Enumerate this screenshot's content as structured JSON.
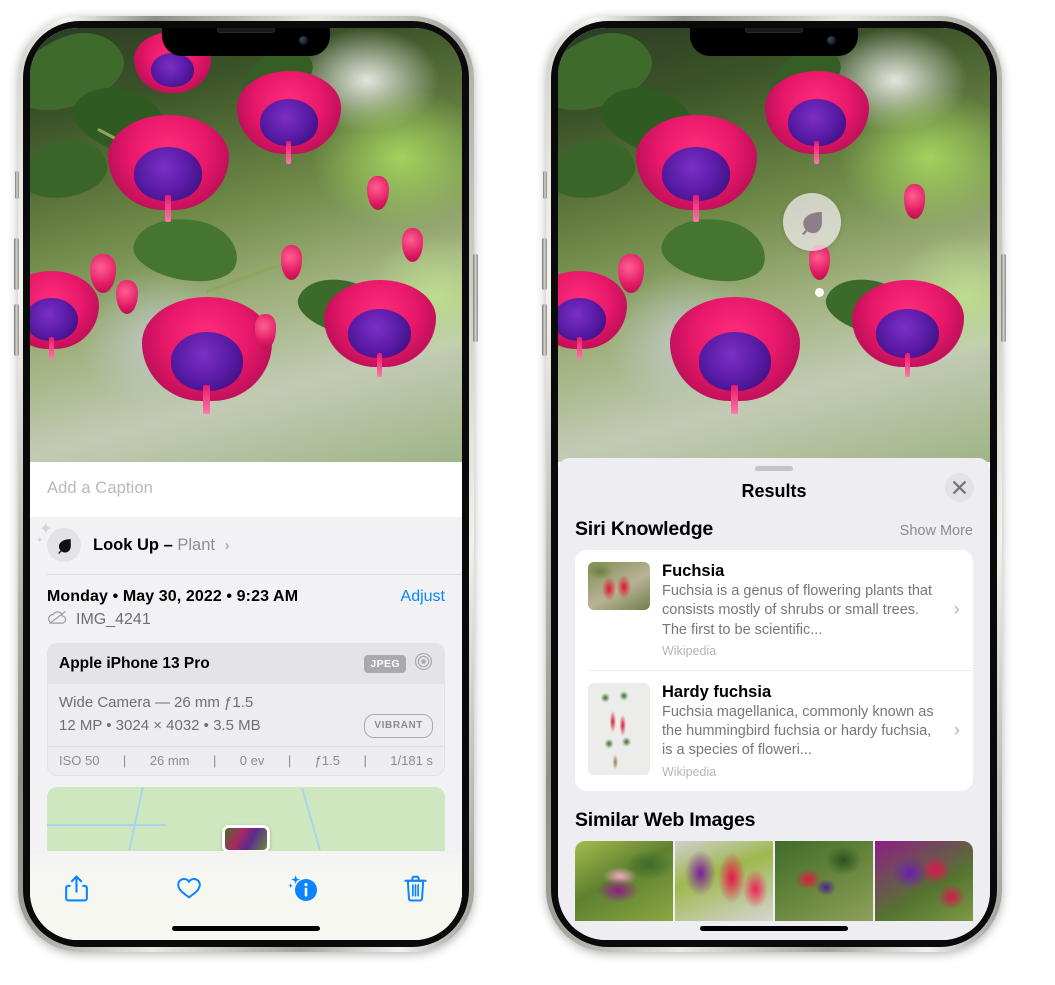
{
  "left_phone": {
    "caption_placeholder": "Add a Caption",
    "lookup": {
      "label": "Look Up –",
      "subject": "Plant",
      "chevron": "›",
      "icon": "leaf-icon"
    },
    "date_line": "Monday • May 30, 2022 • 9:23 AM",
    "adjust_label": "Adjust",
    "file_name": "IMG_4241",
    "cloud_icon": "cloud-slash-icon",
    "exif": {
      "device": "Apple iPhone 13 Pro",
      "format_badge": "JPEG",
      "lens_icon": "aperture-icon",
      "lens_line": "Wide Camera — 26 mm ƒ1.5",
      "size_line": "12 MP • 3024 × 4032 • 3.5 MB",
      "style_badge": "VIBRANT",
      "stats": [
        "ISO 50",
        "26 mm",
        "0 ev",
        "ƒ1.5",
        "1/181 s"
      ],
      "separator": "|"
    },
    "toolbar": {
      "share_label": "share-icon",
      "favorite_label": "heart-icon",
      "info_label": "info-sparkle-icon",
      "delete_label": "trash-icon"
    }
  },
  "right_phone": {
    "badge": {
      "icon": "leaf-icon"
    },
    "sheet_title": "Results",
    "close_icon": "close-icon",
    "sections": [
      {
        "title": "Siri Knowledge",
        "action": "Show More",
        "items": [
          {
            "title": "Fuchsia",
            "description": "Fuchsia is a genus of flowering plants that consists mostly of shrubs or small trees. The first to be scientific...",
            "source": "Wikipedia",
            "chevron": "›"
          },
          {
            "title": "Hardy fuchsia",
            "description": "Fuchsia magellanica, commonly known as the hummingbird fuchsia or hardy fuchsia, is a species of floweri...",
            "source": "Wikipedia",
            "chevron": "›"
          }
        ]
      },
      {
        "title": "Similar Web Images",
        "thumbnail_count": 4
      }
    ]
  },
  "colors": {
    "accent_blue": "#0a84ff",
    "sheet_bg": "#eeeef2",
    "card_bg": "#ffffff",
    "secondary_text": "#8a8a90"
  }
}
